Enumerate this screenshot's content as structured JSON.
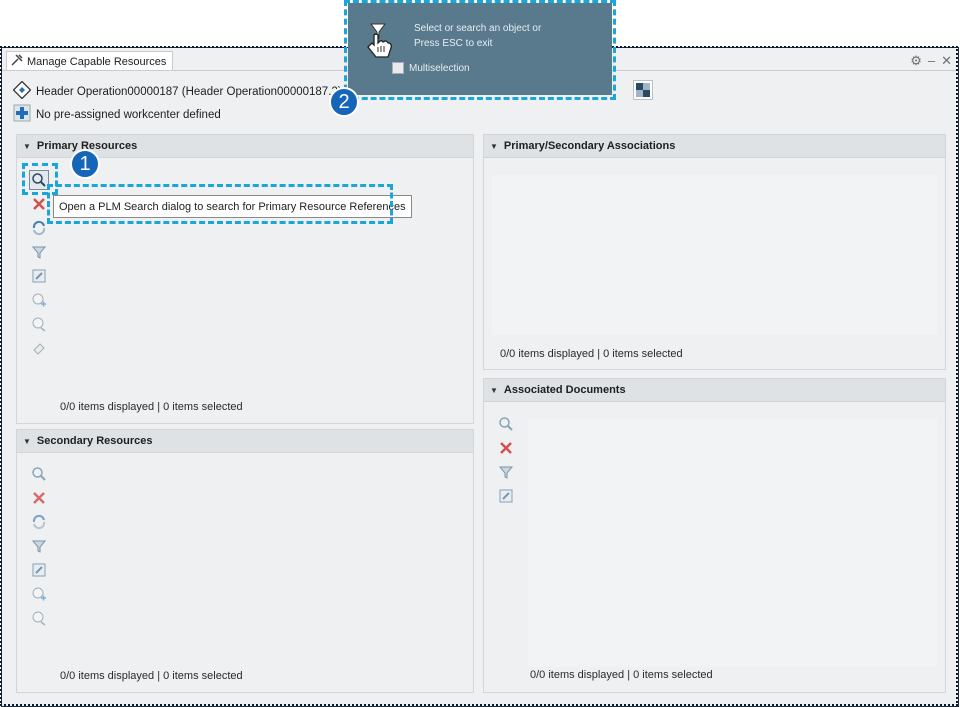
{
  "window": {
    "title": "Manage Capable Resources",
    "controls": [
      "gear-icon",
      "minimize-icon",
      "close-icon"
    ]
  },
  "header": {
    "operation": "Header Operation00000187 (Header Operation00000187.2)",
    "workcenter": "No pre-assigned workcenter defined"
  },
  "primary_resources": {
    "title": "Primary Resources",
    "tooltip": "Open a PLM Search dialog to search for Primary Resource References",
    "status": "0/0 items displayed | 0 items selected",
    "tools": [
      "search-icon",
      "delete-icon",
      "refresh-icon",
      "filter-icon",
      "edit-icon",
      "zoom-add-icon",
      "zoom-remove-icon",
      "eraser-icon"
    ]
  },
  "secondary_resources": {
    "title": "Secondary Resources",
    "status": "0/0 items displayed | 0 items selected",
    "tools": [
      "search-icon",
      "delete-icon",
      "refresh-icon",
      "filter-icon",
      "edit-icon",
      "zoom-add-icon",
      "zoom-remove-icon"
    ]
  },
  "associations": {
    "title": "Primary/Secondary Associations",
    "status": "0/0 items displayed | 0 items selected"
  },
  "documents": {
    "title": "Associated Documents",
    "status": "0/0 items displayed | 0 items selected",
    "tools": [
      "search-icon",
      "delete-icon",
      "filter-icon",
      "edit-icon"
    ]
  },
  "selection_popup": {
    "line1": "Select or search an object or",
    "line2": "Press ESC to exit",
    "multiselection": "Multiselection"
  },
  "callouts": {
    "one": "1",
    "two": "2"
  },
  "colors": {
    "accent": "#1565b8",
    "callout_border": "#1aa6d8",
    "popup_bg": "#587a8c"
  }
}
